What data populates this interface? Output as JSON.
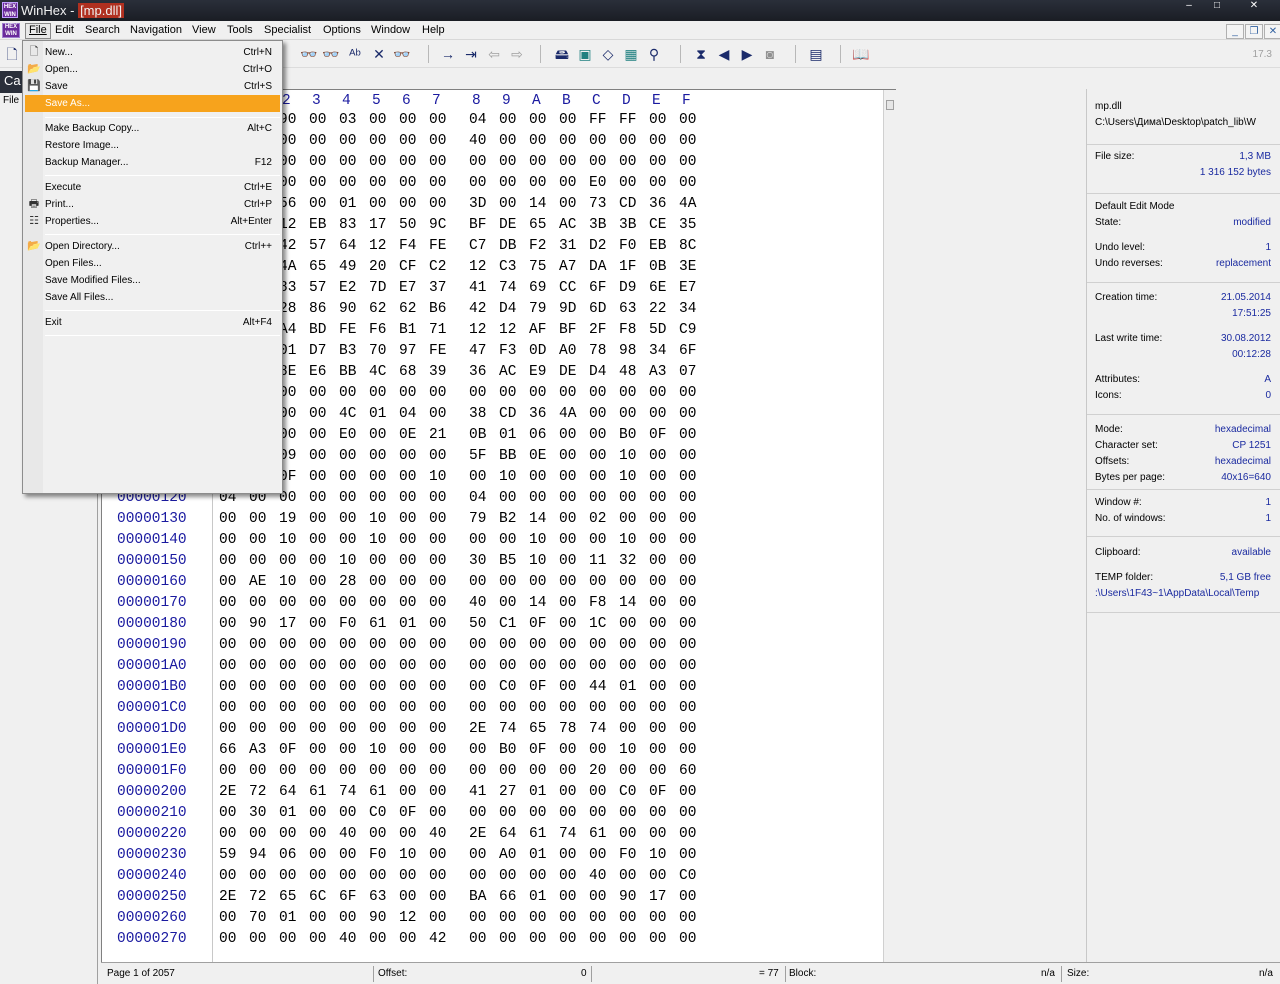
{
  "window": {
    "app_name": "WinHex - ",
    "doc_name": "[mp.dll]",
    "minimize": "–",
    "maximize": "□",
    "close": "✕"
  },
  "menubar": {
    "items": [
      "File",
      "Edit",
      "Search",
      "Navigation",
      "View",
      "Tools",
      "Specialist",
      "Options",
      "Window",
      "Help"
    ]
  },
  "toolbar": {
    "version": "17.3"
  },
  "left": {
    "tab_label": "Ca",
    "file_tab": "File"
  },
  "file_menu": {
    "items": [
      {
        "label": "New...",
        "shortcut": "Ctrl+N",
        "icon": "new-file-icon"
      },
      {
        "label": "Open...",
        "shortcut": "Ctrl+O",
        "icon": "open-folder-icon"
      },
      {
        "label": "Save",
        "shortcut": "Ctrl+S",
        "icon": "save-disk-icon"
      },
      {
        "label": "Save As...",
        "shortcut": "",
        "icon": ""
      },
      {
        "label": "Make Backup Copy...",
        "shortcut": "Alt+C",
        "icon": ""
      },
      {
        "label": "Restore Image...",
        "shortcut": "",
        "icon": ""
      },
      {
        "label": "Backup Manager...",
        "shortcut": "F12",
        "icon": ""
      },
      {
        "label": "Execute",
        "shortcut": "Ctrl+E",
        "icon": ""
      },
      {
        "label": "Print...",
        "shortcut": "Ctrl+P",
        "icon": "printer-icon"
      },
      {
        "label": "Properties...",
        "shortcut": "Alt+Enter",
        "icon": "properties-icon"
      },
      {
        "label": "Open Directory...",
        "shortcut": "Ctrl++",
        "icon": "open-directory-icon"
      },
      {
        "label": "Open Files...",
        "shortcut": "",
        "icon": ""
      },
      {
        "label": "Save Modified Files...",
        "shortcut": "",
        "icon": ""
      },
      {
        "label": "Save All Files...",
        "shortcut": "",
        "icon": ""
      },
      {
        "label": "Exit",
        "shortcut": "Alt+F4",
        "icon": ""
      }
    ],
    "highlighted": "Save As..."
  },
  "hex": {
    "header_cols": [
      "2",
      "3",
      "4",
      "5",
      "6",
      "7",
      "8",
      "9",
      "A",
      "B",
      "C",
      "D",
      "E",
      "F"
    ],
    "rows": [
      {
        "off": "",
        "bytes": [
          "90",
          "00",
          "03",
          "00",
          "00",
          "00",
          "04",
          "00",
          "00",
          "00",
          "FF",
          "FF",
          "00",
          "00"
        ]
      },
      {
        "off": "",
        "bytes": [
          "00",
          "00",
          "00",
          "00",
          "00",
          "00",
          "40",
          "00",
          "00",
          "00",
          "00",
          "00",
          "00",
          "00"
        ]
      },
      {
        "off": "",
        "bytes": [
          "00",
          "00",
          "00",
          "00",
          "00",
          "00",
          "00",
          "00",
          "00",
          "00",
          "00",
          "00",
          "00",
          "00"
        ]
      },
      {
        "off": "",
        "bytes": [
          "00",
          "00",
          "00",
          "00",
          "00",
          "00",
          "00",
          "00",
          "00",
          "00",
          "E0",
          "00",
          "00",
          "00"
        ]
      },
      {
        "off": "",
        "bytes": [
          "56",
          "00",
          "01",
          "00",
          "00",
          "00",
          "3D",
          "00",
          "14",
          "00",
          "73",
          "CD",
          "36",
          "4A"
        ]
      },
      {
        "off": "",
        "bytes": [
          "12",
          "EB",
          "83",
          "17",
          "50",
          "9C",
          "BF",
          "DE",
          "65",
          "AC",
          "3B",
          "3B",
          "CE",
          "35"
        ]
      },
      {
        "off": "",
        "bytes": [
          "42",
          "57",
          "64",
          "12",
          "F4",
          "FE",
          "C7",
          "DB",
          "F2",
          "31",
          "D2",
          "F0",
          "EB",
          "8C"
        ]
      },
      {
        "off": "",
        "bytes": [
          "4A",
          "65",
          "49",
          "20",
          "CF",
          "C2",
          "12",
          "C3",
          "75",
          "A7",
          "DA",
          "1F",
          "0B",
          "3E"
        ]
      },
      {
        "off": "",
        "bytes": [
          "83",
          "57",
          "E2",
          "7D",
          "E7",
          "37",
          "41",
          "74",
          "69",
          "CC",
          "6F",
          "D9",
          "6E",
          "E7"
        ]
      },
      {
        "off": "",
        "bytes": [
          "28",
          "86",
          "90",
          "62",
          "62",
          "B6",
          "42",
          "D4",
          "79",
          "9D",
          "6D",
          "63",
          "22",
          "34"
        ]
      },
      {
        "off": "",
        "bytes": [
          "A4",
          "BD",
          "FE",
          "F6",
          "B1",
          "71",
          "12",
          "12",
          "AF",
          "BF",
          "2F",
          "F8",
          "5D",
          "C9"
        ]
      },
      {
        "off": "",
        "bytes": [
          "01",
          "D7",
          "B3",
          "70",
          "97",
          "FE",
          "47",
          "F3",
          "0D",
          "A0",
          "78",
          "98",
          "34",
          "6F"
        ]
      },
      {
        "off": "",
        "bytes": [
          "8E",
          "E6",
          "BB",
          "4C",
          "68",
          "39",
          "36",
          "AC",
          "E9",
          "DE",
          "D4",
          "48",
          "A3",
          "07"
        ]
      },
      {
        "off": "",
        "bytes": [
          "00",
          "00",
          "00",
          "00",
          "00",
          "00",
          "00",
          "00",
          "00",
          "00",
          "00",
          "00",
          "00",
          "00"
        ]
      },
      {
        "off": "",
        "bytes": [
          "00",
          "00",
          "4C",
          "01",
          "04",
          "00",
          "38",
          "CD",
          "36",
          "4A",
          "00",
          "00",
          "00",
          "00"
        ]
      },
      {
        "off": "",
        "bytes": [
          "00",
          "00",
          "E0",
          "00",
          "0E",
          "21",
          "0B",
          "01",
          "06",
          "00",
          "00",
          "B0",
          "0F",
          "00"
        ]
      },
      {
        "off": "",
        "bytes": [
          "09",
          "00",
          "00",
          "00",
          "00",
          "00",
          "5F",
          "BB",
          "0E",
          "00",
          "00",
          "10",
          "00",
          "00"
        ]
      },
      {
        "off": "",
        "bytes": [
          "0F",
          "00",
          "00",
          "00",
          "00",
          "10",
          "00",
          "10",
          "00",
          "00",
          "00",
          "10",
          "00",
          "00"
        ]
      },
      {
        "off": "00000120",
        "bytes": [
          "04",
          "00",
          "00",
          "00",
          "00",
          "00",
          "00",
          "00",
          "04",
          "00",
          "00",
          "00",
          "00",
          "00",
          "00",
          "00"
        ]
      },
      {
        "off": "00000130",
        "bytes": [
          "00",
          "00",
          "19",
          "00",
          "00",
          "10",
          "00",
          "00",
          "79",
          "B2",
          "14",
          "00",
          "02",
          "00",
          "00",
          "00"
        ]
      },
      {
        "off": "00000140",
        "bytes": [
          "00",
          "00",
          "10",
          "00",
          "00",
          "10",
          "00",
          "00",
          "00",
          "00",
          "10",
          "00",
          "00",
          "10",
          "00",
          "00"
        ]
      },
      {
        "off": "00000150",
        "bytes": [
          "00",
          "00",
          "00",
          "00",
          "10",
          "00",
          "00",
          "00",
          "30",
          "B5",
          "10",
          "00",
          "11",
          "32",
          "00",
          "00"
        ]
      },
      {
        "off": "00000160",
        "bytes": [
          "00",
          "AE",
          "10",
          "00",
          "28",
          "00",
          "00",
          "00",
          "00",
          "00",
          "00",
          "00",
          "00",
          "00",
          "00",
          "00"
        ]
      },
      {
        "off": "00000170",
        "bytes": [
          "00",
          "00",
          "00",
          "00",
          "00",
          "00",
          "00",
          "00",
          "40",
          "00",
          "14",
          "00",
          "F8",
          "14",
          "00",
          "00"
        ]
      },
      {
        "off": "00000180",
        "bytes": [
          "00",
          "90",
          "17",
          "00",
          "F0",
          "61",
          "01",
          "00",
          "50",
          "C1",
          "0F",
          "00",
          "1C",
          "00",
          "00",
          "00"
        ]
      },
      {
        "off": "00000190",
        "bytes": [
          "00",
          "00",
          "00",
          "00",
          "00",
          "00",
          "00",
          "00",
          "00",
          "00",
          "00",
          "00",
          "00",
          "00",
          "00",
          "00"
        ]
      },
      {
        "off": "000001A0",
        "bytes": [
          "00",
          "00",
          "00",
          "00",
          "00",
          "00",
          "00",
          "00",
          "00",
          "00",
          "00",
          "00",
          "00",
          "00",
          "00",
          "00"
        ]
      },
      {
        "off": "000001B0",
        "bytes": [
          "00",
          "00",
          "00",
          "00",
          "00",
          "00",
          "00",
          "00",
          "00",
          "C0",
          "0F",
          "00",
          "44",
          "01",
          "00",
          "00"
        ]
      },
      {
        "off": "000001C0",
        "bytes": [
          "00",
          "00",
          "00",
          "00",
          "00",
          "00",
          "00",
          "00",
          "00",
          "00",
          "00",
          "00",
          "00",
          "00",
          "00",
          "00"
        ]
      },
      {
        "off": "000001D0",
        "bytes": [
          "00",
          "00",
          "00",
          "00",
          "00",
          "00",
          "00",
          "00",
          "2E",
          "74",
          "65",
          "78",
          "74",
          "00",
          "00",
          "00"
        ]
      },
      {
        "off": "000001E0",
        "bytes": [
          "66",
          "A3",
          "0F",
          "00",
          "00",
          "10",
          "00",
          "00",
          "00",
          "B0",
          "0F",
          "00",
          "00",
          "10",
          "00",
          "00"
        ]
      },
      {
        "off": "000001F0",
        "bytes": [
          "00",
          "00",
          "00",
          "00",
          "00",
          "00",
          "00",
          "00",
          "00",
          "00",
          "00",
          "00",
          "20",
          "00",
          "00",
          "60"
        ]
      },
      {
        "off": "00000200",
        "bytes": [
          "2E",
          "72",
          "64",
          "61",
          "74",
          "61",
          "00",
          "00",
          "41",
          "27",
          "01",
          "00",
          "00",
          "C0",
          "0F",
          "00"
        ]
      },
      {
        "off": "00000210",
        "bytes": [
          "00",
          "30",
          "01",
          "00",
          "00",
          "C0",
          "0F",
          "00",
          "00",
          "00",
          "00",
          "00",
          "00",
          "00",
          "00",
          "00"
        ]
      },
      {
        "off": "00000220",
        "bytes": [
          "00",
          "00",
          "00",
          "00",
          "40",
          "00",
          "00",
          "40",
          "2E",
          "64",
          "61",
          "74",
          "61",
          "00",
          "00",
          "00"
        ]
      },
      {
        "off": "00000230",
        "bytes": [
          "59",
          "94",
          "06",
          "00",
          "00",
          "F0",
          "10",
          "00",
          "00",
          "A0",
          "01",
          "00",
          "00",
          "F0",
          "10",
          "00"
        ]
      },
      {
        "off": "00000240",
        "bytes": [
          "00",
          "00",
          "00",
          "00",
          "00",
          "00",
          "00",
          "00",
          "00",
          "00",
          "00",
          "00",
          "40",
          "00",
          "00",
          "C0"
        ]
      },
      {
        "off": "00000250",
        "bytes": [
          "2E",
          "72",
          "65",
          "6C",
          "6F",
          "63",
          "00",
          "00",
          "BA",
          "66",
          "01",
          "00",
          "00",
          "90",
          "17",
          "00"
        ]
      },
      {
        "off": "00000260",
        "bytes": [
          "00",
          "70",
          "01",
          "00",
          "00",
          "90",
          "12",
          "00",
          "00",
          "00",
          "00",
          "00",
          "00",
          "00",
          "00",
          "00"
        ]
      },
      {
        "off": "00000270",
        "bytes": [
          "00",
          "00",
          "00",
          "00",
          "40",
          "00",
          "00",
          "42",
          "00",
          "00",
          "00",
          "00",
          "00",
          "00",
          "00",
          "00"
        ]
      }
    ]
  },
  "info": {
    "file_name": "mp.dll",
    "file_path": "C:\\Users\\Дима\\Desktop\\patch_lib\\W",
    "file_size_label": "File size:",
    "file_size": "1,3 MB",
    "file_size_bytes": "1 316 152 bytes",
    "edit_mode": "Default Edit Mode",
    "state_label": "State:",
    "state": "modified",
    "undo_level_label": "Undo level:",
    "undo_level": "1",
    "undo_reverses_label": "Undo reverses:",
    "undo_reverses": "replacement",
    "creation_label": "Creation time:",
    "creation_date": "21.05.2014",
    "creation_time": "17:51:25",
    "lastwrite_label": "Last write time:",
    "lastwrite_date": "30.08.2012",
    "lastwrite_time": "00:12:28",
    "attributes_label": "Attributes:",
    "attributes": "A",
    "icons_label": "Icons:",
    "icons": "0",
    "mode_label": "Mode:",
    "mode": "hexadecimal",
    "charset_label": "Character set:",
    "charset": "CP 1251",
    "offsets_label": "Offsets:",
    "offsets": "hexadecimal",
    "bpp_label": "Bytes per page:",
    "bpp": "40x16=640",
    "window_label": "Window #:",
    "window": "1",
    "nwindows_label": "No. of windows:",
    "nwindows": "1",
    "clipboard_label": "Clipboard:",
    "clipboard": "available",
    "temp_label": "TEMP folder:",
    "temp_free": "5,1 GB free",
    "temp_path": ":\\Users\\1F43~1\\AppData\\Local\\Temp"
  },
  "status": {
    "page": "Page 1 of 2057",
    "offset_label": "Offset:",
    "offset_value": "0",
    "eq_value": "= 77",
    "block_label": "Block:",
    "block_value": "n/a",
    "size_label": "Size:",
    "size_value": "n/a"
  }
}
